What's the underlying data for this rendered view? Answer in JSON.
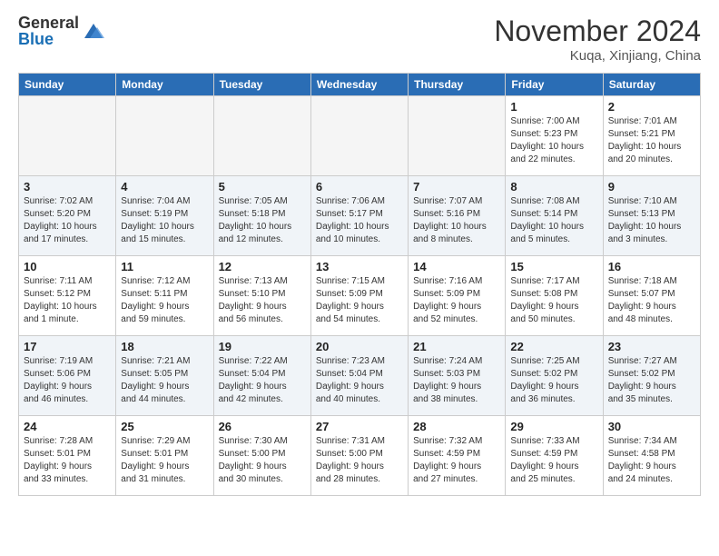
{
  "header": {
    "logo_general": "General",
    "logo_blue": "Blue",
    "month_title": "November 2024",
    "location": "Kuqa, Xinjiang, China"
  },
  "days_of_week": [
    "Sunday",
    "Monday",
    "Tuesday",
    "Wednesday",
    "Thursday",
    "Friday",
    "Saturday"
  ],
  "weeks": [
    [
      {
        "day": "",
        "info": ""
      },
      {
        "day": "",
        "info": ""
      },
      {
        "day": "",
        "info": ""
      },
      {
        "day": "",
        "info": ""
      },
      {
        "day": "",
        "info": ""
      },
      {
        "day": "1",
        "info": "Sunrise: 7:00 AM\nSunset: 5:23 PM\nDaylight: 10 hours\nand 22 minutes."
      },
      {
        "day": "2",
        "info": "Sunrise: 7:01 AM\nSunset: 5:21 PM\nDaylight: 10 hours\nand 20 minutes."
      }
    ],
    [
      {
        "day": "3",
        "info": "Sunrise: 7:02 AM\nSunset: 5:20 PM\nDaylight: 10 hours\nand 17 minutes."
      },
      {
        "day": "4",
        "info": "Sunrise: 7:04 AM\nSunset: 5:19 PM\nDaylight: 10 hours\nand 15 minutes."
      },
      {
        "day": "5",
        "info": "Sunrise: 7:05 AM\nSunset: 5:18 PM\nDaylight: 10 hours\nand 12 minutes."
      },
      {
        "day": "6",
        "info": "Sunrise: 7:06 AM\nSunset: 5:17 PM\nDaylight: 10 hours\nand 10 minutes."
      },
      {
        "day": "7",
        "info": "Sunrise: 7:07 AM\nSunset: 5:16 PM\nDaylight: 10 hours\nand 8 minutes."
      },
      {
        "day": "8",
        "info": "Sunrise: 7:08 AM\nSunset: 5:14 PM\nDaylight: 10 hours\nand 5 minutes."
      },
      {
        "day": "9",
        "info": "Sunrise: 7:10 AM\nSunset: 5:13 PM\nDaylight: 10 hours\nand 3 minutes."
      }
    ],
    [
      {
        "day": "10",
        "info": "Sunrise: 7:11 AM\nSunset: 5:12 PM\nDaylight: 10 hours\nand 1 minute."
      },
      {
        "day": "11",
        "info": "Sunrise: 7:12 AM\nSunset: 5:11 PM\nDaylight: 9 hours\nand 59 minutes."
      },
      {
        "day": "12",
        "info": "Sunrise: 7:13 AM\nSunset: 5:10 PM\nDaylight: 9 hours\nand 56 minutes."
      },
      {
        "day": "13",
        "info": "Sunrise: 7:15 AM\nSunset: 5:09 PM\nDaylight: 9 hours\nand 54 minutes."
      },
      {
        "day": "14",
        "info": "Sunrise: 7:16 AM\nSunset: 5:09 PM\nDaylight: 9 hours\nand 52 minutes."
      },
      {
        "day": "15",
        "info": "Sunrise: 7:17 AM\nSunset: 5:08 PM\nDaylight: 9 hours\nand 50 minutes."
      },
      {
        "day": "16",
        "info": "Sunrise: 7:18 AM\nSunset: 5:07 PM\nDaylight: 9 hours\nand 48 minutes."
      }
    ],
    [
      {
        "day": "17",
        "info": "Sunrise: 7:19 AM\nSunset: 5:06 PM\nDaylight: 9 hours\nand 46 minutes."
      },
      {
        "day": "18",
        "info": "Sunrise: 7:21 AM\nSunset: 5:05 PM\nDaylight: 9 hours\nand 44 minutes."
      },
      {
        "day": "19",
        "info": "Sunrise: 7:22 AM\nSunset: 5:04 PM\nDaylight: 9 hours\nand 42 minutes."
      },
      {
        "day": "20",
        "info": "Sunrise: 7:23 AM\nSunset: 5:04 PM\nDaylight: 9 hours\nand 40 minutes."
      },
      {
        "day": "21",
        "info": "Sunrise: 7:24 AM\nSunset: 5:03 PM\nDaylight: 9 hours\nand 38 minutes."
      },
      {
        "day": "22",
        "info": "Sunrise: 7:25 AM\nSunset: 5:02 PM\nDaylight: 9 hours\nand 36 minutes."
      },
      {
        "day": "23",
        "info": "Sunrise: 7:27 AM\nSunset: 5:02 PM\nDaylight: 9 hours\nand 35 minutes."
      }
    ],
    [
      {
        "day": "24",
        "info": "Sunrise: 7:28 AM\nSunset: 5:01 PM\nDaylight: 9 hours\nand 33 minutes."
      },
      {
        "day": "25",
        "info": "Sunrise: 7:29 AM\nSunset: 5:01 PM\nDaylight: 9 hours\nand 31 minutes."
      },
      {
        "day": "26",
        "info": "Sunrise: 7:30 AM\nSunset: 5:00 PM\nDaylight: 9 hours\nand 30 minutes."
      },
      {
        "day": "27",
        "info": "Sunrise: 7:31 AM\nSunset: 5:00 PM\nDaylight: 9 hours\nand 28 minutes."
      },
      {
        "day": "28",
        "info": "Sunrise: 7:32 AM\nSunset: 4:59 PM\nDaylight: 9 hours\nand 27 minutes."
      },
      {
        "day": "29",
        "info": "Sunrise: 7:33 AM\nSunset: 4:59 PM\nDaylight: 9 hours\nand 25 minutes."
      },
      {
        "day": "30",
        "info": "Sunrise: 7:34 AM\nSunset: 4:58 PM\nDaylight: 9 hours\nand 24 minutes."
      }
    ]
  ]
}
